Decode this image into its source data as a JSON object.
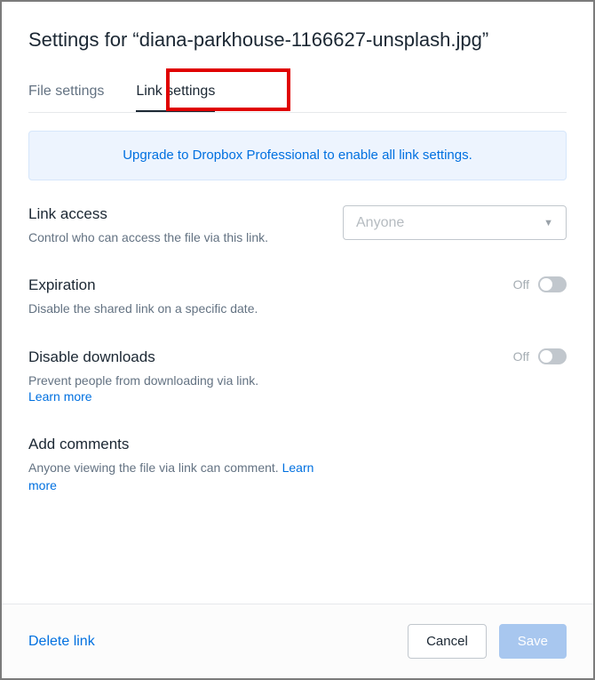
{
  "title": "Settings for “diana-parkhouse-1166627-unsplash.jpg”",
  "tabs": {
    "file_settings": "File settings",
    "link_settings": "Link settings"
  },
  "upgrade_banner": "Upgrade to Dropbox Professional to enable all link settings.",
  "link_access": {
    "title": "Link access",
    "desc": "Control who can access the file via this link.",
    "selected": "Anyone"
  },
  "expiration": {
    "title": "Expiration",
    "desc": "Disable the shared link on a specific date.",
    "state": "Off"
  },
  "disable_downloads": {
    "title": "Disable downloads",
    "desc": "Prevent people from downloading via link.",
    "learn_more": "Learn more",
    "state": "Off"
  },
  "add_comments": {
    "title": "Add comments",
    "desc_prefix": "Anyone viewing the file via link can comment. ",
    "learn_more": "Learn more"
  },
  "footer": {
    "delete_link": "Delete link",
    "cancel": "Cancel",
    "save": "Save"
  }
}
